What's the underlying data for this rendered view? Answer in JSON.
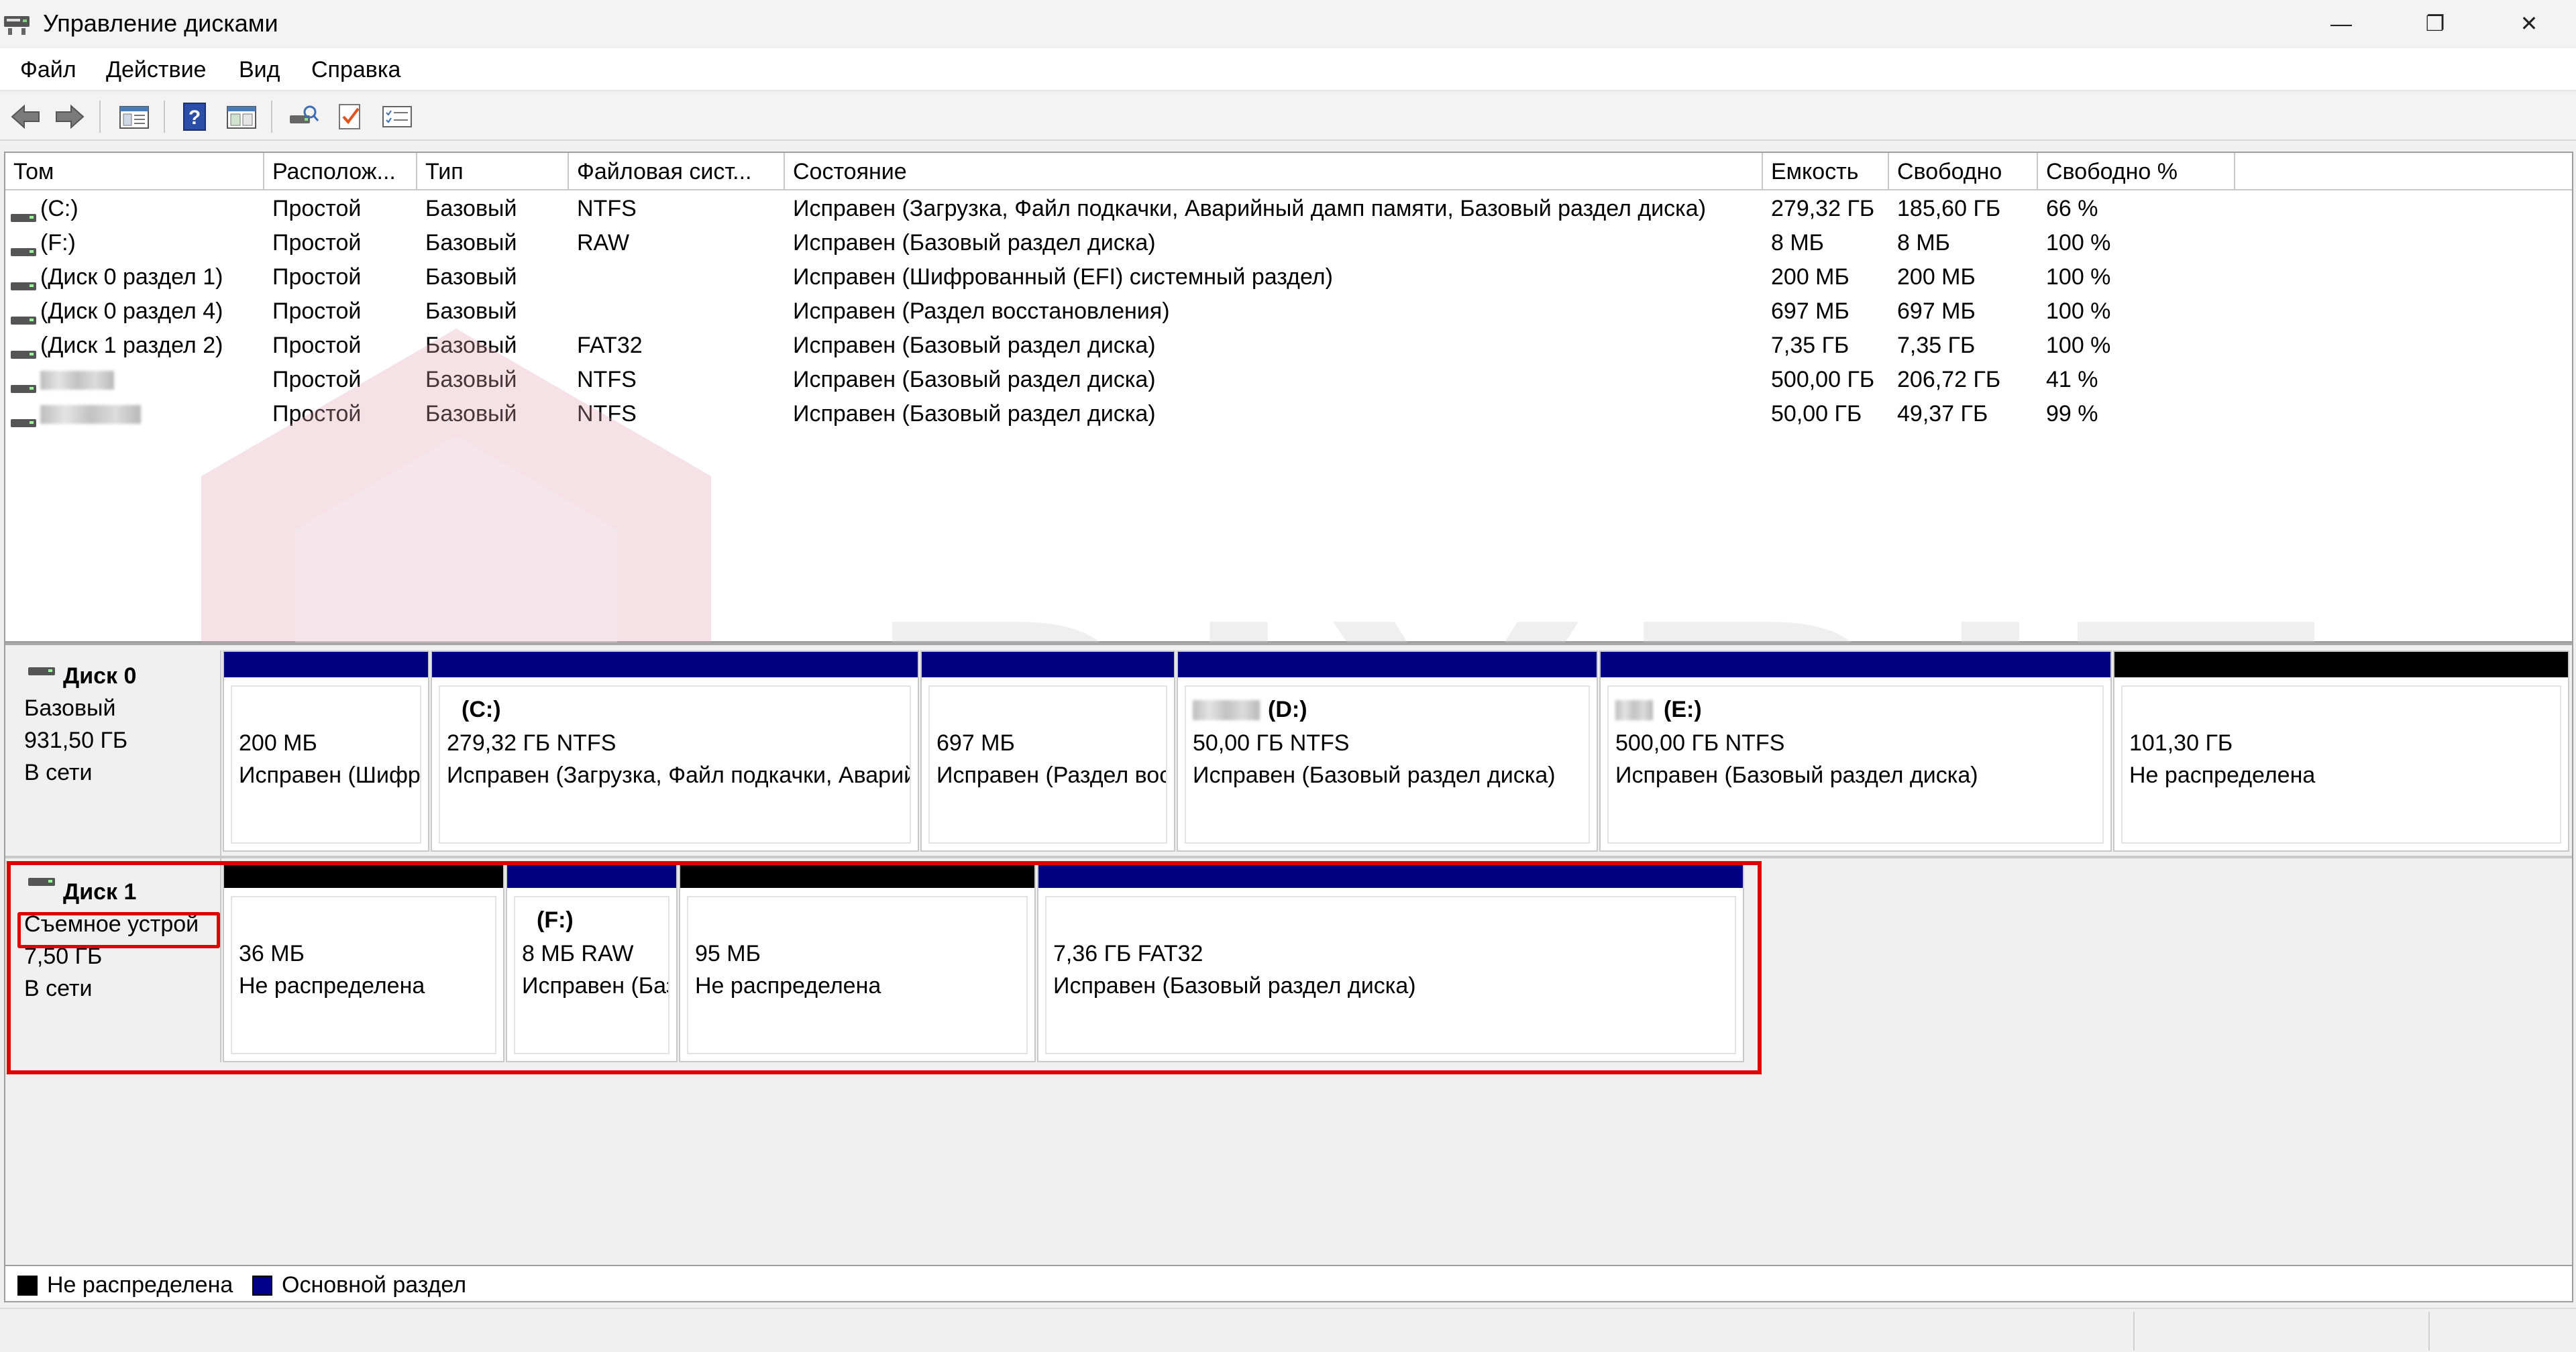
{
  "window": {
    "title": "Управление дисками",
    "controls": [
      "—",
      "❐",
      "✕"
    ]
  },
  "menu": {
    "items": [
      "Файл",
      "Действие",
      "Вид",
      "Справка"
    ]
  },
  "toolbar": {
    "icons": [
      "back-icon",
      "forward-icon",
      "console-tree-icon",
      "help-icon",
      "view-icon",
      "properties-icon",
      "check-icon",
      "list-icon"
    ]
  },
  "volume_table": {
    "columns": [
      "Том",
      "Располож...",
      "Тип",
      "Файловая сист...",
      "Состояние",
      "Емкость",
      "Свободно",
      "Свободно %"
    ],
    "rows": [
      {
        "volume": "(C:)",
        "layout": "Простой",
        "type": "Базовый",
        "fs": "NTFS",
        "status": "Исправен (Загрузка, Файл подкачки, Аварийный дамп памяти, Базовый раздел диска)",
        "capacity": "279,32 ГБ",
        "free": "185,60 ГБ",
        "free_pct": "66 %"
      },
      {
        "volume": "(F:)",
        "layout": "Простой",
        "type": "Базовый",
        "fs": "RAW",
        "status": "Исправен (Базовый раздел диска)",
        "capacity": "8 МБ",
        "free": "8 МБ",
        "free_pct": "100 %"
      },
      {
        "volume": "(Диск 0 раздел 1)",
        "layout": "Простой",
        "type": "Базовый",
        "fs": "",
        "status": "Исправен (Шифрованный (EFI) системный раздел)",
        "capacity": "200 МБ",
        "free": "200 МБ",
        "free_pct": "100 %"
      },
      {
        "volume": "(Диск 0 раздел 4)",
        "layout": "Простой",
        "type": "Базовый",
        "fs": "",
        "status": "Исправен (Раздел восстановления)",
        "capacity": "697 МБ",
        "free": "697 МБ",
        "free_pct": "100 %"
      },
      {
        "volume": "(Диск 1 раздел 2)",
        "layout": "Простой",
        "type": "Базовый",
        "fs": "FAT32",
        "status": "Исправен (Базовый раздел диска)",
        "capacity": "7,35 ГБ",
        "free": "7,35 ГБ",
        "free_pct": "100 %"
      },
      {
        "volume": "",
        "layout": "Простой",
        "type": "Базовый",
        "fs": "NTFS",
        "status": "Исправен (Базовый раздел диска)",
        "capacity": "500,00 ГБ",
        "free": "206,72 ГБ",
        "free_pct": "41 %"
      },
      {
        "volume": "",
        "layout": "Простой",
        "type": "Базовый",
        "fs": "NTFS",
        "status": "Исправен (Базовый раздел диска)",
        "capacity": "50,00 ГБ",
        "free": "49,37 ГБ",
        "free_pct": "99 %"
      }
    ]
  },
  "disks": [
    {
      "name": "Диск 0",
      "type": "Базовый",
      "size": "931,50 ГБ",
      "state": "В сети",
      "partitions": [
        {
          "title": "",
          "size": "200 МБ",
          "status": "Исправен (Шифрованный (EFI) системный раздел)",
          "kind": "primary"
        },
        {
          "title": "(C:)",
          "size": "279,32 ГБ NTFS",
          "status": "Исправен (Загрузка, Файл подкачки, Аварийный дамп памяти, Базовый раздел диска)",
          "kind": "primary"
        },
        {
          "title": "",
          "size": "697 МБ",
          "status": "Исправен (Раздел восстановления)",
          "kind": "primary"
        },
        {
          "title": "(D:)",
          "size": "50,00 ГБ NTFS",
          "status": "Исправен (Базовый раздел диска)",
          "kind": "primary"
        },
        {
          "title": "(E:)",
          "size": "500,00 ГБ NTFS",
          "status": "Исправен (Базовый раздел диска)",
          "kind": "primary"
        },
        {
          "title": "",
          "size": "101,30 ГБ",
          "status": "Не распределена",
          "kind": "unallocated"
        }
      ]
    },
    {
      "name": "Диск 1",
      "type": "Съемное устрой",
      "size": "7,50 ГБ",
      "state": "В сети",
      "partitions": [
        {
          "title": "",
          "size": "36 МБ",
          "status": "Не распределена",
          "kind": "unallocated"
        },
        {
          "title": "(F:)",
          "size": "8 МБ RAW",
          "status": "Исправен (Базовый раздел диска)",
          "kind": "primary"
        },
        {
          "title": "",
          "size": "95 МБ",
          "status": "Не распределена",
          "kind": "unallocated"
        },
        {
          "title": "",
          "size": "7,36 ГБ FAT32",
          "status": "Исправен (Базовый раздел диска)",
          "kind": "primary"
        }
      ]
    }
  ],
  "legend": [
    {
      "label": "Не распределена",
      "color": "#000000"
    },
    {
      "label": "Основной раздел",
      "color": "#00008b"
    }
  ],
  "colors": {
    "primary": "#000080",
    "unallocated": "#000000",
    "highlight": "#e00000"
  },
  "watermark": "BIXBIT"
}
